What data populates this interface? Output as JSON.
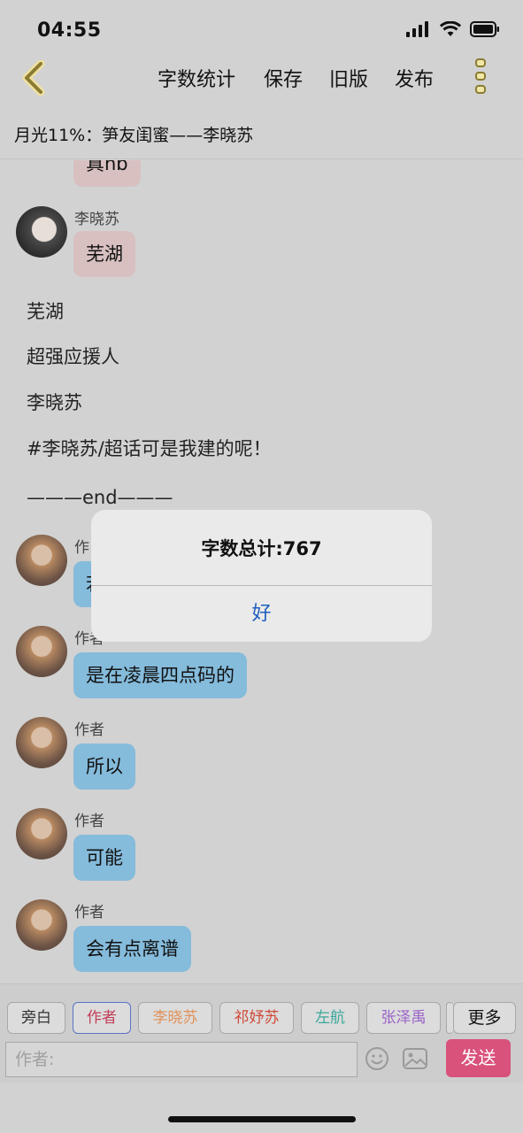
{
  "status": {
    "time": "04:55"
  },
  "nav": {
    "word_count": "字数统计",
    "save": "保存",
    "old_version": "旧版",
    "publish": "发布"
  },
  "title": "月光11%：笋友闺蜜——李晓苏",
  "messages": {
    "cut_bubble": "真nb",
    "m1": {
      "sender": "李晓苏",
      "text": "芜湖"
    },
    "narration": [
      "芜湖",
      "超强应援人",
      "李晓苏",
      "#李晓苏/超话可是我建的呢！",
      "———end———"
    ],
    "m2": {
      "sender": "作",
      "text": "若"
    },
    "m3": {
      "sender": "作者",
      "text": "是在凌晨四点码的"
    },
    "m4": {
      "sender": "作者",
      "text": "所以"
    },
    "m5": {
      "sender": "作者",
      "text": "可能"
    },
    "m6": {
      "sender": "作者",
      "text": "会有点离谱"
    }
  },
  "dialog": {
    "message": "字数总计:767",
    "ok": "好"
  },
  "roles": [
    {
      "label": "旁白",
      "color": "#333333"
    },
    {
      "label": "作者",
      "color": "#c2405a"
    },
    {
      "label": "李晓苏",
      "color": "#e0925a"
    },
    {
      "label": "祁妤苏",
      "color": "#cf4a3a"
    },
    {
      "label": "左航",
      "color": "#3aa89a"
    },
    {
      "label": "张泽禹",
      "color": "#9a63c8"
    }
  ],
  "more": "更多",
  "input": {
    "placeholder": "作者:"
  },
  "send": "发送"
}
